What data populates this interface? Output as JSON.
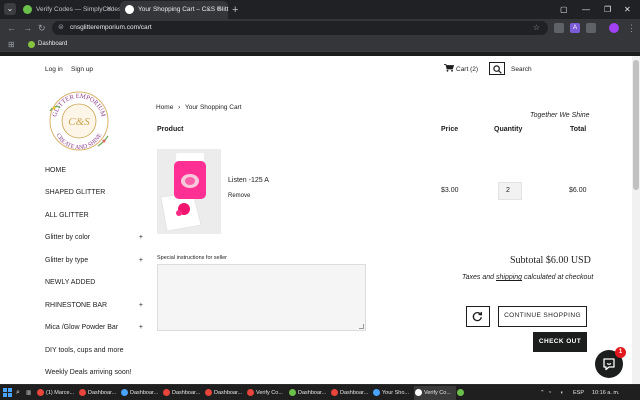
{
  "browser": {
    "tabs": [
      {
        "title": "Verify Codes — SimplyCodes",
        "fav_color": "#6bc04b"
      },
      {
        "title": "Your Shopping Cart – C&S Glitt",
        "fav_color": "#ffffff"
      }
    ],
    "url": "cnsglitteremporium.com/cart",
    "bookmark": "Dashboard"
  },
  "header": {
    "login": "Log in",
    "signup": "Sign up",
    "cart": "Cart (2)",
    "search": "Search"
  },
  "logo": {
    "top_text": "GLITTER EMPORIUM",
    "initials": "C&S",
    "bottom_text": "CREATE AND SHINE"
  },
  "sidenav": [
    {
      "label": "HOME",
      "expand": ""
    },
    {
      "label": "SHAPED GLITTER",
      "expand": ""
    },
    {
      "label": "ALL GLITTER",
      "expand": ""
    },
    {
      "label": "Glitter by color",
      "expand": "+"
    },
    {
      "label": "Glitter by type",
      "expand": "+"
    },
    {
      "label": "NEWLY ADDED",
      "expand": ""
    },
    {
      "label": "RHINESTONE BAR",
      "expand": "+"
    },
    {
      "label": "Mica /Glow Powder Bar",
      "expand": "+"
    },
    {
      "label": "DIY tools, cups and more",
      "expand": ""
    },
    {
      "label": "Weekly Deals arriving soon!",
      "expand": ""
    }
  ],
  "breadcrumb": {
    "home": "Home",
    "separator": "›",
    "current": "Your Shopping Cart"
  },
  "tagline": "Together We Shine",
  "columns": {
    "product": "Product",
    "price": "Price",
    "quantity": "Quantity",
    "total": "Total"
  },
  "item": {
    "name": "Listen -125 A",
    "remove": "Remove",
    "price": "$3.00",
    "quantity": "2",
    "total": "$6.00"
  },
  "notes_label": "Special instructions for seller",
  "subtotal": "Subtotal $6.00 USD",
  "tax_note": {
    "before": "Taxes and ",
    "link": "shipping",
    "after": " calculated at checkout"
  },
  "buttons": {
    "continue": "CONTINUE SHOPPING",
    "checkout": "CHECK OUT"
  },
  "chat_badge": "1",
  "taskbar": {
    "items": [
      {
        "label": "(1) Marce...",
        "fav_color": "#e8453c"
      },
      {
        "label": "Dashboar...",
        "fav_color": "#e8453c"
      },
      {
        "label": "Dashboar...",
        "fav_color": "#4aa3ff"
      },
      {
        "label": "Dashboar...",
        "fav_color": "#e8453c"
      },
      {
        "label": "Dashboar...",
        "fav_color": "#e8453c"
      },
      {
        "label": "Verify Co...",
        "fav_color": "#6bc04b"
      },
      {
        "label": "Dashboar...",
        "fav_color": "#e8453c"
      },
      {
        "label": "Dashboar...",
        "fav_color": "#4aa3ff"
      },
      {
        "label": "Your Sho...",
        "fav_color": "#ffffff"
      },
      {
        "label": "Verify Co...",
        "fav_color": "#6bc04b"
      }
    ],
    "language": "ESP",
    "time": "10:16 a. m."
  }
}
